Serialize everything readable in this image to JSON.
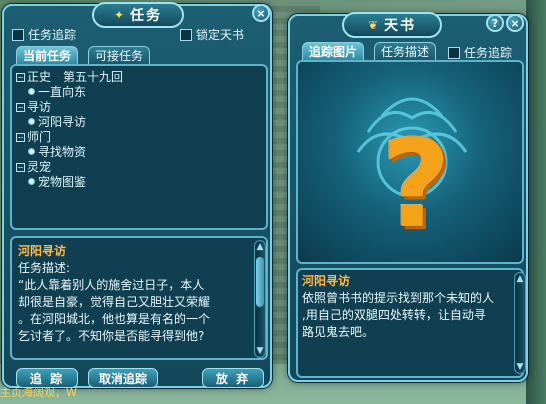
{
  "task_window": {
    "title": "任务",
    "track_checkbox_label": "任务追踪",
    "lock_checkbox_label": "锁定天书",
    "tabs": [
      {
        "label": "当前任务",
        "active": true
      },
      {
        "label": "可接任务",
        "active": false
      }
    ],
    "tree": [
      {
        "type": "cat",
        "label": "正史　第五十九回"
      },
      {
        "type": "sub",
        "label": "一直向东"
      },
      {
        "type": "cat",
        "label": "寻访"
      },
      {
        "type": "sub",
        "label": "河阳寻访"
      },
      {
        "type": "cat",
        "label": "师门"
      },
      {
        "type": "sub",
        "label": "寻找物资"
      },
      {
        "type": "cat",
        "label": "灵宠"
      },
      {
        "type": "sub",
        "label": "宠物图鉴"
      }
    ],
    "detail_title": "河阳寻访",
    "detail_label": "任务描述:",
    "detail_lines": [
      "“此人靠着别人的施舍过日子，本人",
      "却很是自豪，觉得自己又胆壮又荣耀",
      "。在河阳城北，他也算是有名的一个",
      "乞讨者了。不知你是否能寻得到他?"
    ],
    "buttons": {
      "track": "追 踪",
      "cancel_track": "取消追踪",
      "abandon": "放 弃"
    },
    "close_button": "×"
  },
  "book_window": {
    "title": "天书",
    "help_button": "?",
    "close_button": "×",
    "tabs": [
      {
        "label": "追踪图片",
        "active": true
      },
      {
        "label": "任务描述",
        "active": false
      }
    ],
    "track_checkbox_label": "任务追踪",
    "image_glyph": "?",
    "quest_title": "河阳寻访",
    "quest_lines": [
      "依照曾书书的提示找到那个未知的人",
      ",用自己的双腿四处转转，让自动寻",
      "路见鬼去吧。"
    ]
  },
  "footer_text": "主页海阔观，W",
  "colors": {
    "accent": "#7fd2e6",
    "quest_title": "#ffb84a",
    "question_mark": "#f5a21b"
  }
}
